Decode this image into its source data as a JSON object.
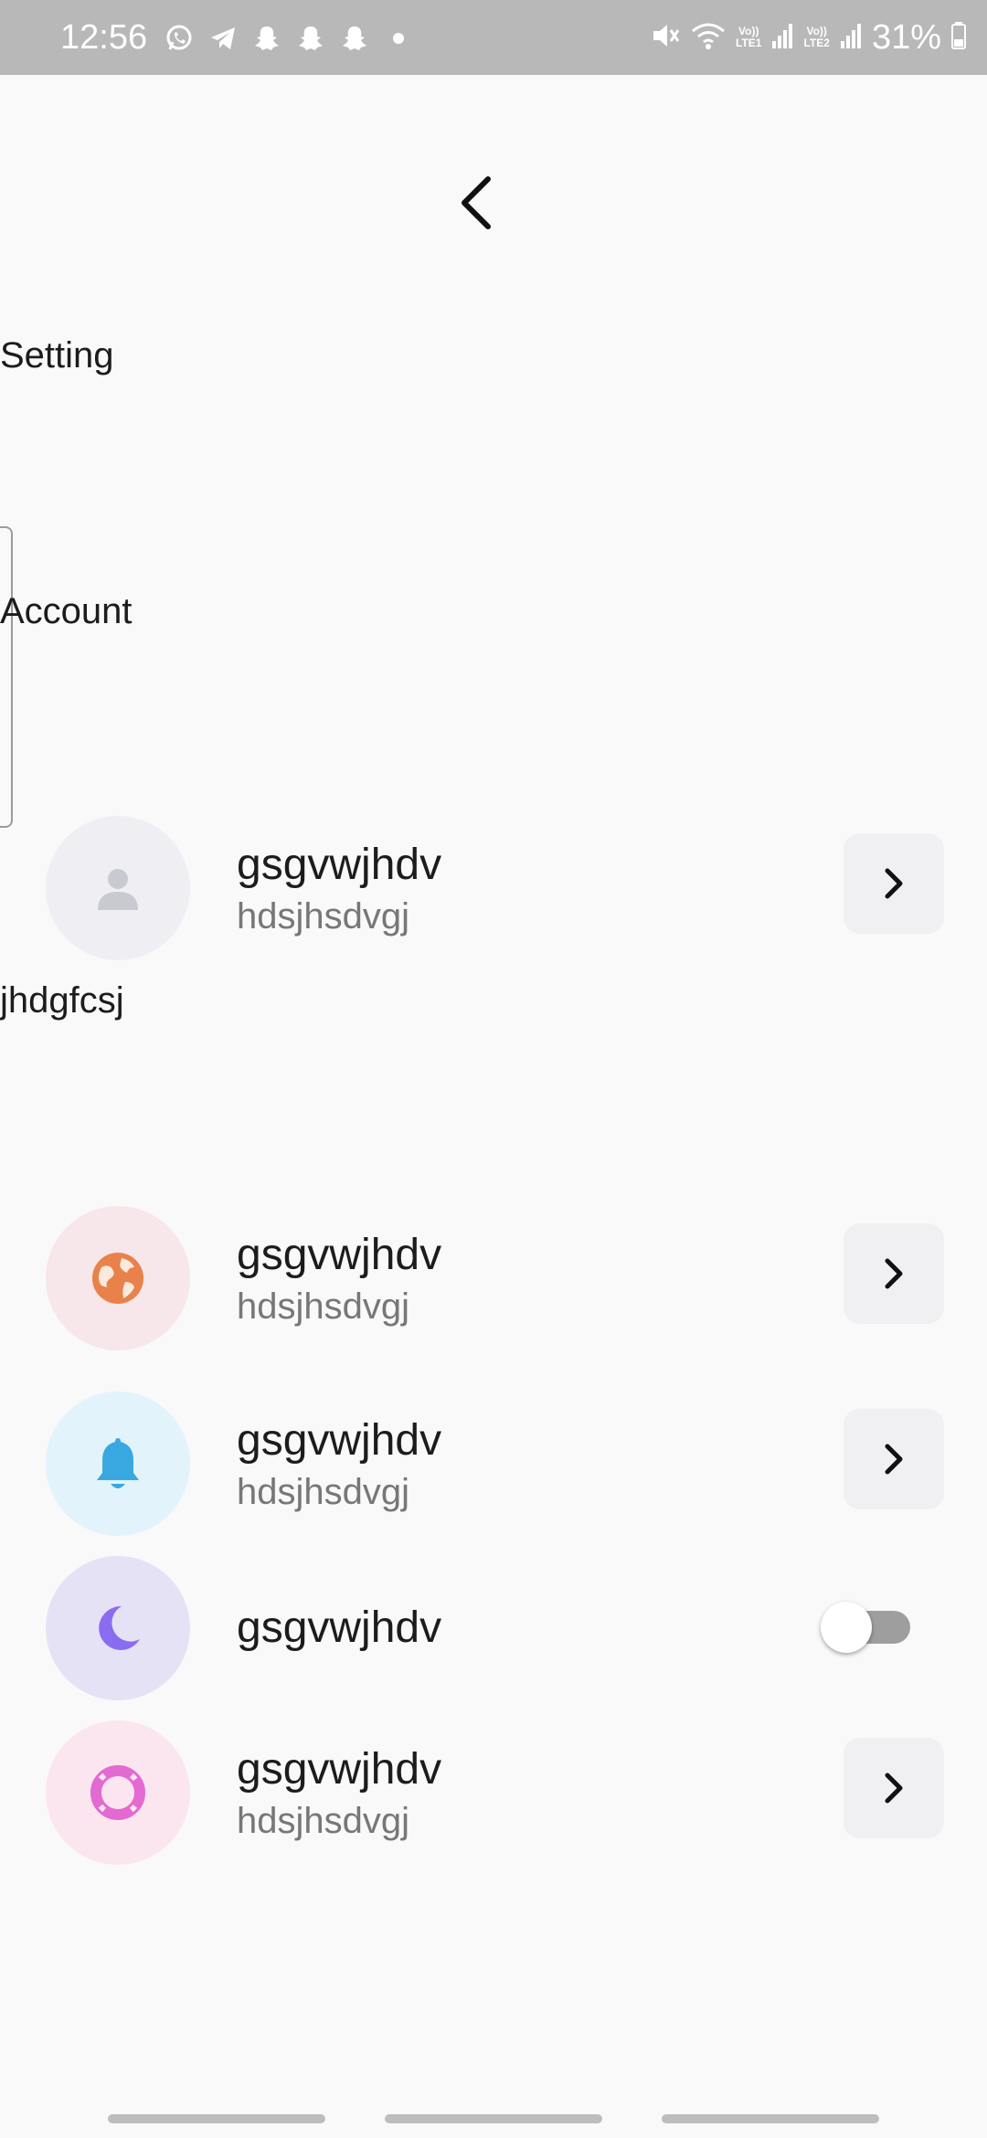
{
  "status_bar": {
    "time": "12:56",
    "battery": "31%",
    "lte1": "LTE1",
    "lte2": "LTE2",
    "volte": "Vo))",
    "app_icons": [
      "whatsapp-icon",
      "telegram-icon",
      "snapchat-icon",
      "snapchat-icon",
      "snapchat-icon",
      "dot-icon"
    ],
    "background_color": "#b8b8b8"
  },
  "header": {
    "back_icon": "chevron-left-icon",
    "title": "Setting"
  },
  "account_section": {
    "label": "Account",
    "row": {
      "title": "gsgvwjhdv",
      "subtitle": "hdsjhsdvgj",
      "icon": "person-icon",
      "icon_color": "#c9c9d1",
      "icon_bg": "#efeff3"
    }
  },
  "settings_section": {
    "label": "jhdgfcsj",
    "rows": [
      {
        "title": "gsgvwjhdv",
        "subtitle": "hdsjhsdvgj",
        "icon": "globe-icon",
        "icon_color": "#e8824a",
        "icon_bg": "#f7e6ea",
        "control": "chevron"
      },
      {
        "title": "gsgvwjhdv",
        "subtitle": "hdsjhsdvgj",
        "icon": "bell-icon",
        "icon_color": "#3aa8e0",
        "icon_bg": "#e2f3fc",
        "control": "chevron"
      },
      {
        "title": "gsgvwjhdv",
        "icon": "moon-icon",
        "icon_color": "#8a6cf0",
        "icon_bg": "#e6e2f6",
        "control": "toggle",
        "toggle_on": false
      },
      {
        "title": "gsgvwjhdv",
        "subtitle": "hdsjhsdvgj",
        "icon": "lifebuoy-icon",
        "icon_color": "#e36ad1",
        "icon_bg": "#fbe6ef",
        "control": "chevron"
      }
    ]
  },
  "colors": {
    "background": "#f9f9f9",
    "chevron_button_bg": "#f0f0f2",
    "toggle_track_off": "#9e9e9e"
  }
}
